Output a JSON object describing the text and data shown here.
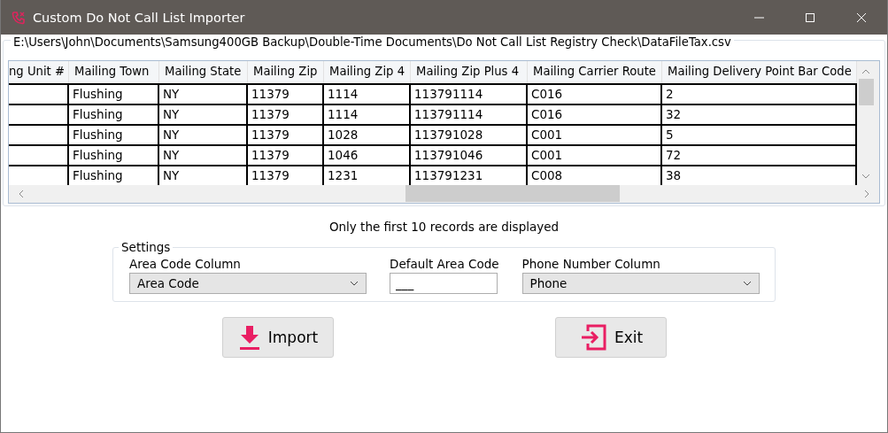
{
  "window": {
    "title": "Custom Do Not Call List Importer"
  },
  "file_path": "E:\\Users\\John\\Documents\\Samsung400GB Backup\\Double-Time Documents\\Do Not Call List Registry Check\\DataFileTax.csv",
  "table": {
    "columns": [
      "ng Unit #",
      "Mailing Town",
      "Mailing State",
      "Mailing Zip",
      "Mailing Zip 4",
      "Mailing Zip Plus 4",
      "Mailing Carrier Route",
      "Mailing Delivery Point Bar Code"
    ],
    "rows": [
      [
        "",
        "Flushing",
        "NY",
        "11379",
        "1114",
        "113791114",
        "C016",
        "2"
      ],
      [
        "",
        "Flushing",
        "NY",
        "11379",
        "1114",
        "113791114",
        "C016",
        "32"
      ],
      [
        "",
        "Flushing",
        "NY",
        "11379",
        "1028",
        "113791028",
        "C001",
        "5"
      ],
      [
        "",
        "Flushing",
        "NY",
        "11379",
        "1046",
        "113791046",
        "C001",
        "72"
      ],
      [
        "",
        "Flushing",
        "NY",
        "11379",
        "1231",
        "113791231",
        "C008",
        "38"
      ]
    ]
  },
  "notice": "Only the first 10 records are displayed",
  "settings": {
    "title": "Settings",
    "fields": [
      {
        "kind": "dropdown",
        "label": "Area Code Column",
        "value": "Area Code"
      },
      {
        "kind": "text",
        "label": "Default Area Code",
        "value": "___"
      },
      {
        "kind": "dropdown",
        "label": "Phone Number Column",
        "value": "Phone"
      }
    ]
  },
  "buttons": [
    {
      "kind": "import",
      "label": "Import"
    },
    {
      "kind": "exit",
      "label": "Exit"
    }
  ]
}
